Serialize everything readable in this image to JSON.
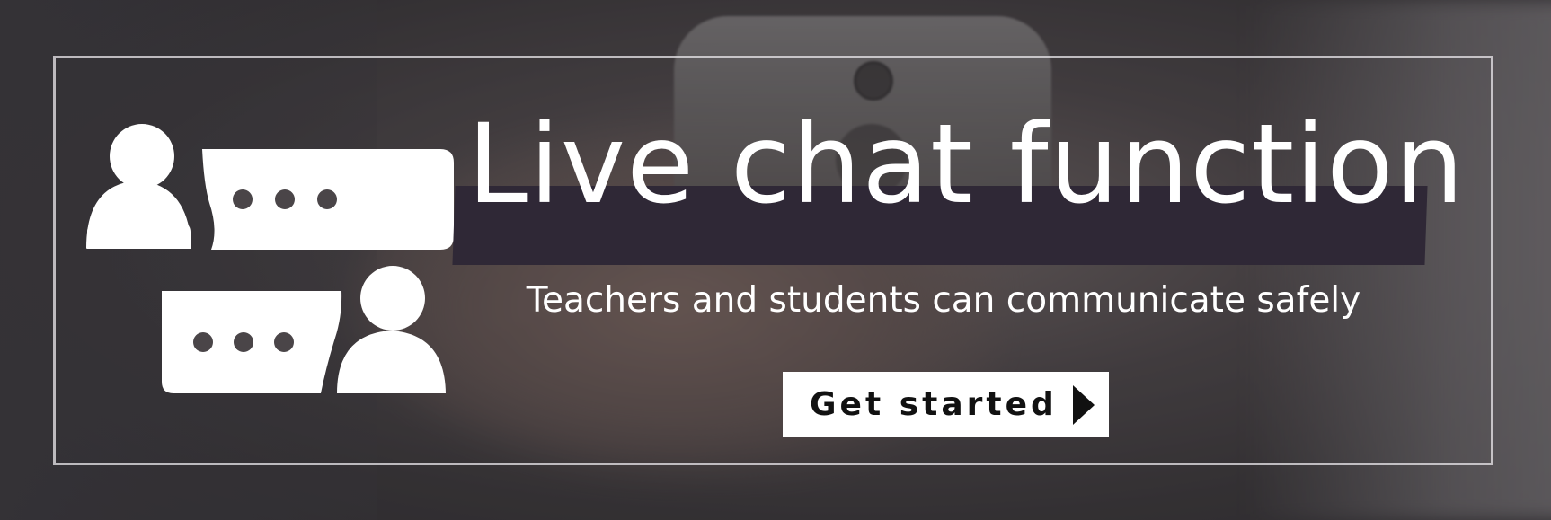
{
  "banner": {
    "title": "Live chat function",
    "subtitle": "Teachers and students can communicate safely",
    "cta_label": "Get started",
    "icons": {
      "chat": "chat-conversation-icon",
      "cta_arrow": "play-arrow-icon"
    },
    "colors": {
      "title_band": "#2f2836",
      "text": "#ffffff",
      "cta_background": "#ffffff",
      "cta_text": "#111111"
    }
  }
}
